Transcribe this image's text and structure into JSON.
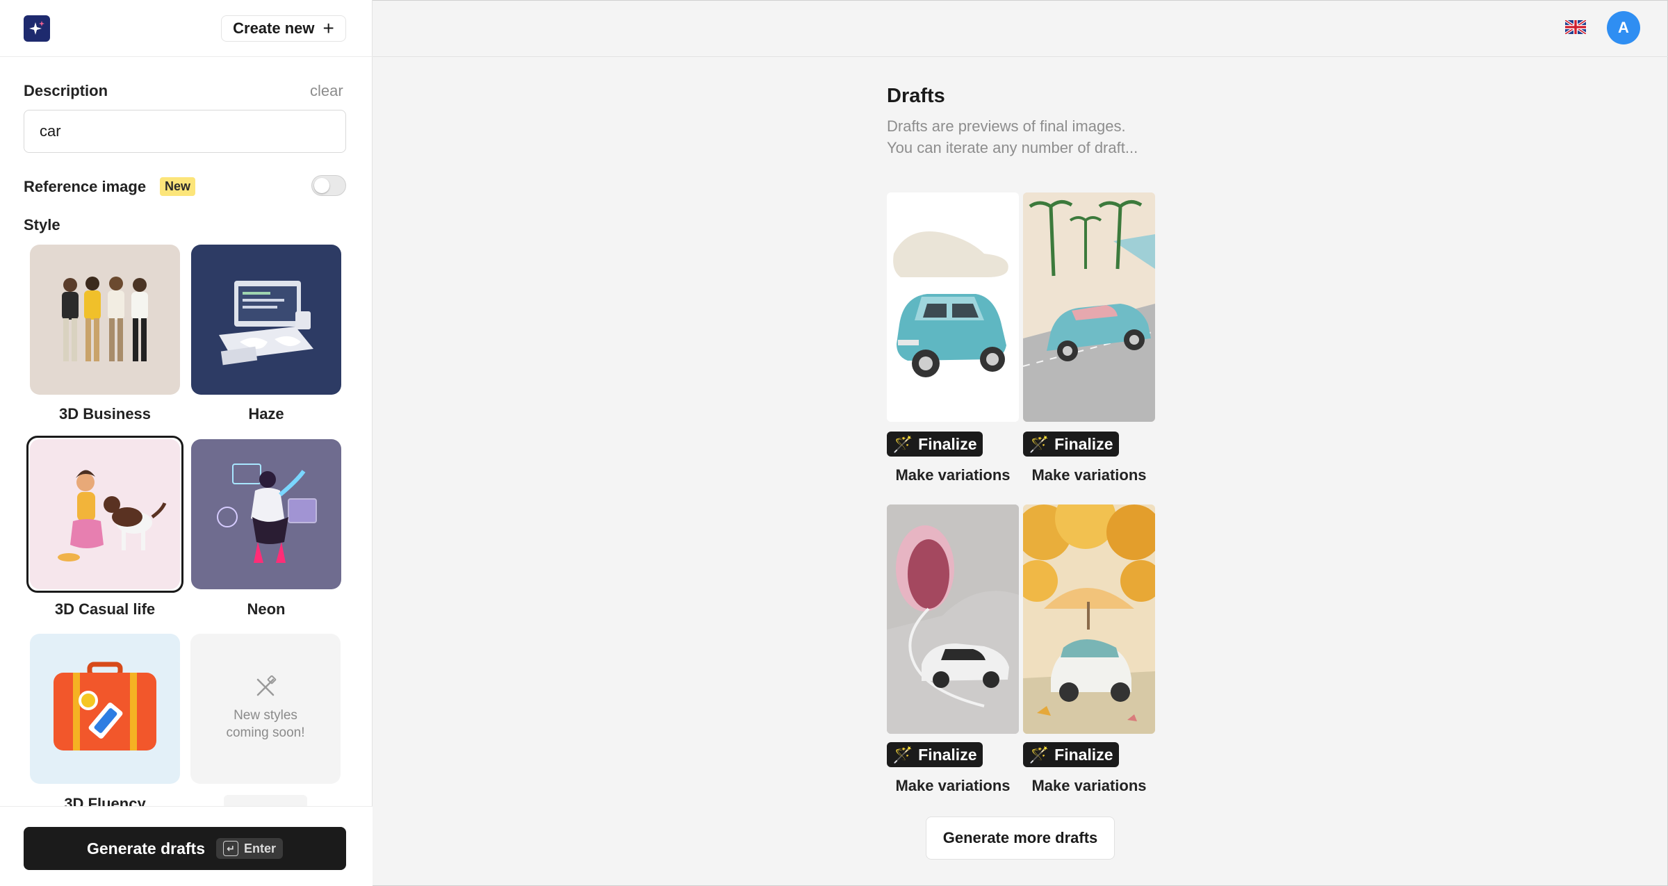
{
  "header": {
    "create_new_label": "Create new",
    "avatar_initial": "A",
    "language_icon": "uk-flag-icon"
  },
  "sidebar": {
    "description_label": "Description",
    "clear_label": "clear",
    "description_value": "car",
    "reference_image_label": "Reference image",
    "new_badge": "New",
    "reference_toggle_on": false,
    "style_label": "Style",
    "styles": [
      {
        "name": "3D Business",
        "selected": false
      },
      {
        "name": "Haze",
        "selected": false
      },
      {
        "name": "3D Casual life",
        "selected": true
      },
      {
        "name": "Neon",
        "selected": false
      },
      {
        "name": "3D Fluency",
        "selected": false
      }
    ],
    "coming_soon_text": "New styles coming soon!",
    "generate_label": "Generate drafts",
    "generate_shortcut": "Enter"
  },
  "main": {
    "title": "Drafts",
    "subtitle_line1": "Drafts are previews of final images.",
    "subtitle_line2": "You can iterate any number of draft...",
    "finalize_label": "Finalize",
    "variations_label": "Make variations",
    "more_drafts_label": "Generate more drafts"
  },
  "colors": {
    "accent": "#2f8ef2",
    "dark_button": "#1b1b1b",
    "new_badge": "#fce57a"
  }
}
